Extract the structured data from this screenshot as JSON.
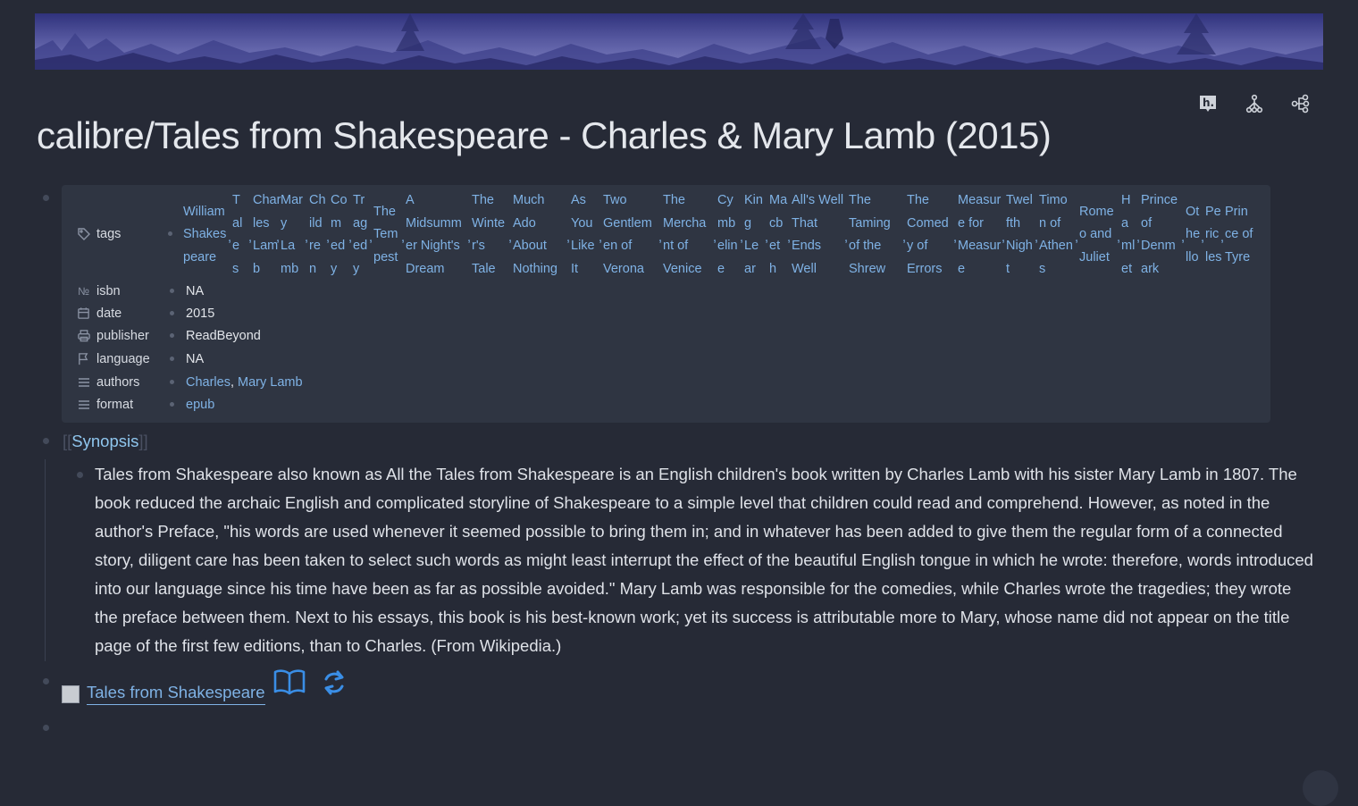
{
  "page": {
    "title": "calibre/Tales from Shakespeare - Charles & Mary Lamb (2015)"
  },
  "toolbar": {
    "icons": [
      "hypothesis-icon",
      "graph-icon",
      "share-tree-icon"
    ],
    "hypothesis_glyph": "h."
  },
  "properties": {
    "tags_label": "tags",
    "tags": [
      [
        "William",
        "Shakes",
        "peare"
      ],
      [
        "T",
        "al",
        "e",
        "s"
      ],
      [
        "Char",
        "les",
        "Lam",
        "b"
      ],
      [
        "Mar",
        "y",
        "La",
        "mb"
      ],
      [
        "Ch",
        "ild",
        "re",
        "n"
      ],
      [
        "Co",
        "m",
        "ed",
        "y"
      ],
      [
        "Tr",
        "ag",
        "ed",
        "y"
      ],
      [
        "The",
        "Tem",
        "pest"
      ],
      [
        "A",
        "Midsumm",
        "er Night's",
        "Dream"
      ],
      [
        "The",
        "Winte",
        "r's",
        "Tale"
      ],
      [
        "Much",
        "Ado",
        "About",
        "Nothing"
      ],
      [
        "As",
        "You",
        "Like",
        "It"
      ],
      [
        "Two",
        "Gentlem",
        "en of",
        "Verona"
      ],
      [
        "The",
        "Mercha",
        "nt of",
        "Venice"
      ],
      [
        "Cy",
        "mb",
        "elin",
        "e"
      ],
      [
        "Kin",
        "g",
        "Le",
        "ar"
      ],
      [
        "Ma",
        "cb",
        "et",
        "h"
      ],
      [
        "All's Well",
        "That",
        "Ends",
        "Well"
      ],
      [
        "The",
        "Taming",
        "of the",
        "Shrew"
      ],
      [
        "The",
        "Comed",
        "y of",
        "Errors"
      ],
      [
        "Measur",
        "e for",
        "Measur",
        "e"
      ],
      [
        "Twel",
        "fth",
        "Nigh",
        "t"
      ],
      [
        "Timo",
        "n of",
        "Athen",
        "s"
      ],
      [
        "Rome",
        "o and",
        "Juliet"
      ],
      [
        "H",
        "a",
        "ml",
        "et"
      ],
      [
        "Prince",
        "of",
        "Denm",
        "ark"
      ],
      [
        "Ot",
        "he",
        "llo"
      ],
      [
        "Pe",
        "ric",
        "les"
      ],
      [
        "Prin",
        "ce of",
        "Tyre"
      ]
    ],
    "rows": [
      {
        "icon": "number-icon",
        "glyph": "№",
        "name": "isbn",
        "value": "NA"
      },
      {
        "icon": "calendar-icon",
        "glyph": "",
        "name": "date",
        "value": "2015"
      },
      {
        "icon": "printer-icon",
        "glyph": "",
        "name": "publisher",
        "value": "ReadBeyond"
      },
      {
        "icon": "flag-icon",
        "glyph": "",
        "name": "language",
        "value": "NA"
      }
    ],
    "authors_label": "authors",
    "authors": [
      "Charles",
      "Mary Lamb"
    ],
    "author_sep": ", ",
    "format_label": "format",
    "format_value": "epub"
  },
  "synopsis": {
    "heading": "Synopsis",
    "open_bracket": "[[",
    "close_bracket": "]]",
    "text": "Tales from Shakespeare also known as All the Tales from Shakespeare is an English children's book written by Charles Lamb with his sister Mary Lamb in 1807. The book reduced the archaic English and complicated storyline of Shakespeare to a simple level that children could read and comprehend. However, as noted in the author's Preface, \"his words are used whenever it seemed possible to bring them in; and in whatever has been added to give them the regular form of a connected story, diligent care has been taken to select such words as might least interrupt the effect of the beautiful English tongue in which he wrote: therefore, words introduced into our language since his time have been as far as possible avoided.\" Mary Lamb was responsible for the comedies, while Charles wrote the tragedies; they wrote the preface between them. Next to his essays, this book is his best-known work; yet its success is attributable more to Mary, whose name did not appear on the title page of the first few editions, than to Charles. (From Wikipedia.)"
  },
  "book": {
    "link_label": "Tales from Shakespeare",
    "open_icon": "open-book-icon",
    "sync_icon": "refresh-icon"
  },
  "colors": {
    "background": "#262a36",
    "panel": "#2f3542",
    "link": "#7fb2e5",
    "accent_icon": "#3a8ee6"
  }
}
